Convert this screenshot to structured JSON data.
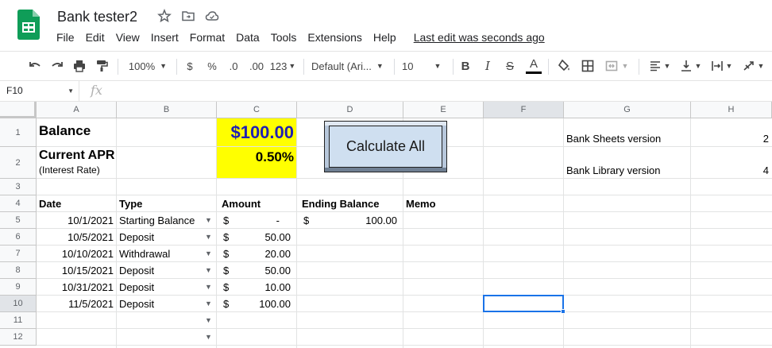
{
  "doc": {
    "title": "Bank tester2",
    "menu": [
      "File",
      "Edit",
      "View",
      "Insert",
      "Format",
      "Data",
      "Tools",
      "Extensions",
      "Help"
    ],
    "last_edit": "Last edit was seconds ago"
  },
  "toolbar": {
    "zoom": "100%",
    "currency": "$",
    "percent": "%",
    "decrease_decimals": ".0",
    "increase_decimals": ".00",
    "more_formats": "123",
    "font": "Default (Ari...",
    "font_size": "10",
    "bold": "B",
    "italic": "I",
    "strikethrough": "S",
    "text_color": "A"
  },
  "formula_bar": {
    "cell_ref": "F10",
    "fx": "fx",
    "value": ""
  },
  "columns": [
    "A",
    "B",
    "C",
    "D",
    "E",
    "F",
    "G",
    "H"
  ],
  "rows": [
    "1",
    "2",
    "3",
    "4",
    "5",
    "6",
    "7",
    "8",
    "9",
    "10",
    "11",
    "12"
  ],
  "sheet": {
    "balance_label": "Balance",
    "balance_value": "$100.00",
    "apr_label": "Current APR",
    "apr_sublabel": "(Interest Rate)",
    "apr_value": "0.50%",
    "button_label": "Calculate All",
    "info": [
      {
        "label": "Bank Sheets version",
        "value": "2"
      },
      {
        "label": "Bank Library version",
        "value": "4"
      }
    ],
    "headers": {
      "date": "Date",
      "type": "Type",
      "amount": "Amount",
      "ending_balance": "Ending Balance",
      "memo": "Memo"
    },
    "transactions": [
      {
        "date": "10/1/2021",
        "type": "Starting Balance",
        "cur": "$",
        "amount": "-",
        "eb_cur": "$",
        "ending_balance": "100.00"
      },
      {
        "date": "10/5/2021",
        "type": "Deposit",
        "cur": "$",
        "amount": "50.00"
      },
      {
        "date": "10/10/2021",
        "type": "Withdrawal",
        "cur": "$",
        "amount": "20.00"
      },
      {
        "date": "10/15/2021",
        "type": "Deposit",
        "cur": "$",
        "amount": "50.00"
      },
      {
        "date": "10/31/2021",
        "type": "Deposit",
        "cur": "$",
        "amount": "10.00"
      },
      {
        "date": "11/5/2021",
        "type": "Deposit",
        "cur": "$",
        "amount": "100.00"
      }
    ]
  },
  "colors": {
    "highlight": "#ffff00",
    "balance_text": "#1f1fb4",
    "selection": "#1a73e8",
    "logo": "#0f9d58"
  }
}
